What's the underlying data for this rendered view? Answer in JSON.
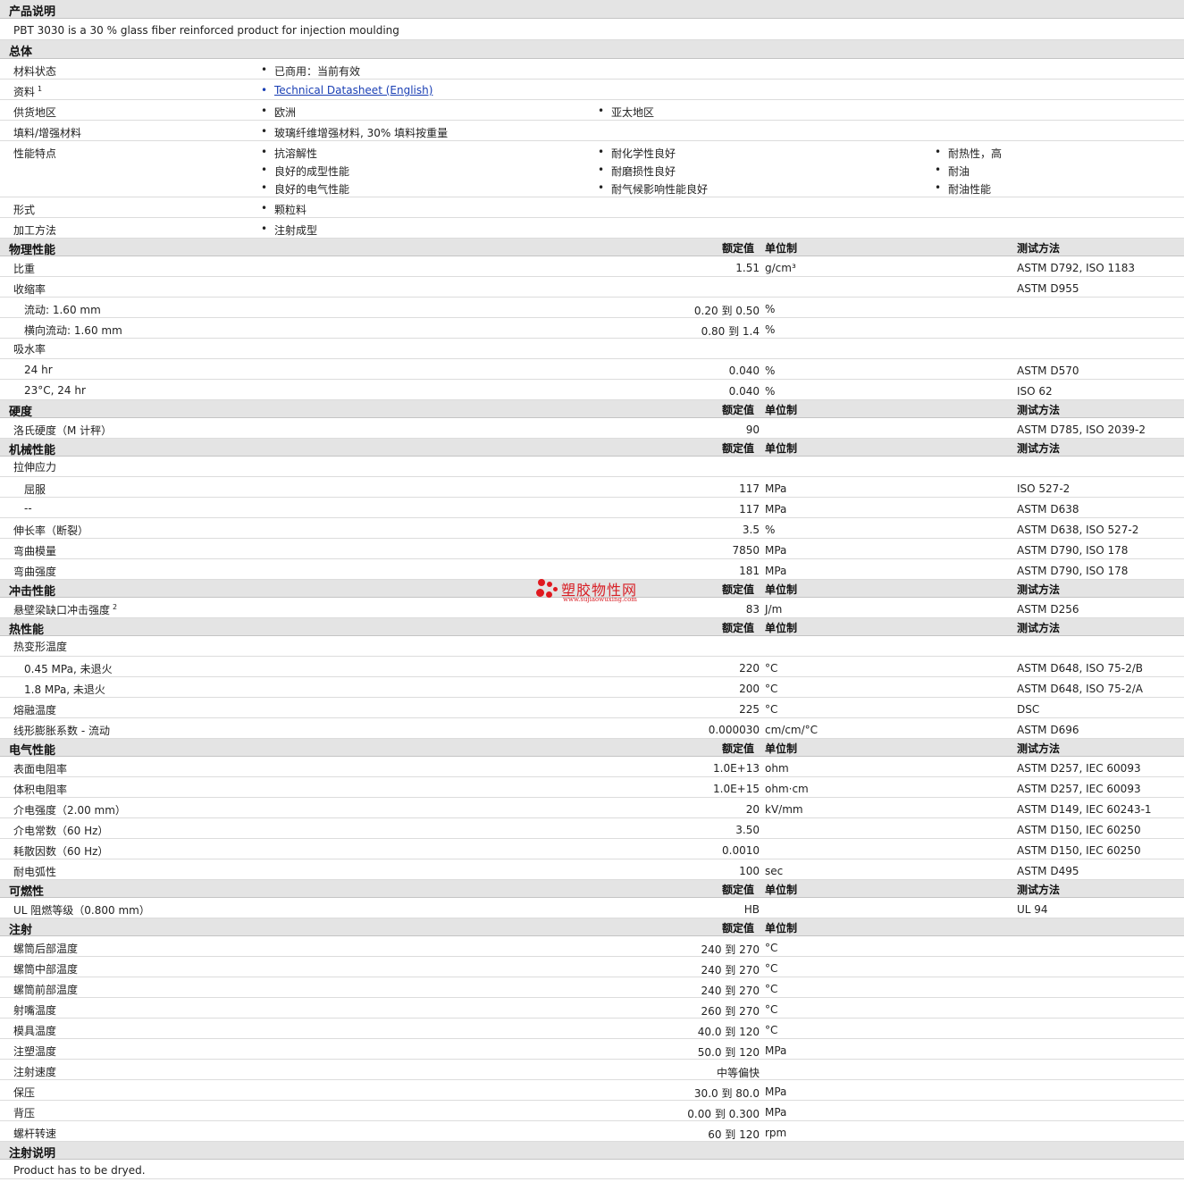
{
  "header_cols": {
    "value": "额定值",
    "unit": "单位制",
    "test": "测试方法"
  },
  "desc": {
    "title": "产品说明",
    "text": "PBT 3030 is a 30 % glass fiber reinforced product for injection moulding"
  },
  "general": {
    "title": "总体",
    "rows": [
      {
        "label": "材料状态",
        "items": [
          "已商用：当前有效"
        ]
      },
      {
        "label": "资料",
        "sup": "1",
        "items": [
          "Technical Datasheet (English)"
        ],
        "link": true
      },
      {
        "label": "供货地区",
        "items": [
          "欧洲",
          "亚太地区"
        ]
      },
      {
        "label": "填料/增强材料",
        "items": [
          "玻璃纤维增强材料, 30% 填料按重量"
        ]
      },
      {
        "label": "性能特点",
        "items": [
          "抗溶解性",
          "耐化学性良好",
          "耐热性，高",
          "良好的成型性能",
          "耐磨损性良好",
          "耐油",
          "良好的电气性能",
          "耐气候影响性能良好",
          "耐油性能"
        ]
      },
      {
        "label": "形式",
        "items": [
          "颗粒料"
        ]
      },
      {
        "label": "加工方法",
        "items": [
          "注射成型"
        ]
      }
    ]
  },
  "sections": [
    {
      "title": "物理性能",
      "rows": [
        {
          "label": "比重",
          "value": "1.51",
          "unit": "g/cm³",
          "test": "ASTM D792, ISO 1183"
        },
        {
          "label": "收缩率",
          "test": "ASTM D955"
        },
        {
          "label": "流动: 1.60 mm",
          "sub": true,
          "value": "0.20 到  0.50",
          "unit": "%"
        },
        {
          "label": "横向流动: 1.60 mm",
          "sub": true,
          "value": "0.80 到  1.4",
          "unit": "%"
        },
        {
          "label": "吸水率"
        },
        {
          "label": "24 hr",
          "sub": true,
          "value": "0.040",
          "unit": "%",
          "test": "ASTM D570"
        },
        {
          "label": "23°C, 24 hr",
          "sub": true,
          "value": "0.040",
          "unit": "%",
          "test": "ISO 62"
        }
      ]
    },
    {
      "title": "硬度",
      "rows": [
        {
          "label": "洛氏硬度（M 计秤）",
          "value": "90",
          "test": "ASTM D785, ISO 2039-2"
        }
      ]
    },
    {
      "title": "机械性能",
      "rows": [
        {
          "label": "拉伸应力"
        },
        {
          "label": "屈服",
          "sub": true,
          "value": "117",
          "unit": "MPa",
          "test": "ISO 527-2"
        },
        {
          "label": "--",
          "sub": true,
          "value": "117",
          "unit": "MPa",
          "test": "ASTM D638"
        },
        {
          "label": "伸长率（断裂）",
          "value": "3.5",
          "unit": "%",
          "test": "ASTM D638, ISO 527-2"
        },
        {
          "label": "弯曲模量",
          "value": "7850",
          "unit": "MPa",
          "test": "ASTM D790, ISO 178"
        },
        {
          "label": "弯曲强度",
          "value": "181",
          "unit": "MPa",
          "test": "ASTM D790, ISO 178"
        }
      ]
    },
    {
      "title": "冲击性能",
      "rows": [
        {
          "label": "悬壁梁缺口冲击强度",
          "sup": "2",
          "value": "83",
          "unit": "J/m",
          "test": "ASTM D256"
        }
      ]
    },
    {
      "title": "热性能",
      "rows": [
        {
          "label": "热变形温度"
        },
        {
          "label": "0.45 MPa, 未退火",
          "sub": true,
          "value": "220",
          "unit": "°C",
          "test": "ASTM D648, ISO 75-2/B"
        },
        {
          "label": "1.8 MPa, 未退火",
          "sub": true,
          "value": "200",
          "unit": "°C",
          "test": "ASTM D648, ISO 75-2/A"
        },
        {
          "label": "熔融温度",
          "value": "225",
          "unit": "°C",
          "test": "DSC"
        },
        {
          "label": "线形膨胀系数  - 流动",
          "value": "0.000030",
          "unit": "cm/cm/°C",
          "test": "ASTM D696"
        }
      ]
    },
    {
      "title": "电气性能",
      "rows": [
        {
          "label": "表面电阻率",
          "value": "1.0E+13",
          "unit": "ohm",
          "test": "ASTM D257, IEC 60093"
        },
        {
          "label": "体积电阻率",
          "value": "1.0E+15",
          "unit": "ohm·cm",
          "test": "ASTM D257, IEC 60093"
        },
        {
          "label": "介电强度（2.00 mm）",
          "value": "20",
          "unit": "kV/mm",
          "test": "ASTM D149, IEC 60243-1"
        },
        {
          "label": "介电常数（60 Hz）",
          "value": "3.50",
          "test": "ASTM D150, IEC 60250"
        },
        {
          "label": "耗散因数（60 Hz）",
          "value": "0.0010",
          "test": "ASTM D150, IEC 60250"
        },
        {
          "label": "耐电弧性",
          "value": "100",
          "unit": "sec",
          "test": "ASTM D495"
        }
      ]
    },
    {
      "title": "可燃性",
      "rows": [
        {
          "label": "UL 阻燃等级（0.800 mm）",
          "value": "HB",
          "test": "UL 94"
        }
      ]
    },
    {
      "title": "注射",
      "no_test": true,
      "rows": [
        {
          "label": "螺筒后部温度",
          "value": "240 到  270",
          "unit": "°C"
        },
        {
          "label": "螺筒中部温度",
          "value": "240 到  270",
          "unit": "°C"
        },
        {
          "label": "螺筒前部温度",
          "value": "240 到  270",
          "unit": "°C"
        },
        {
          "label": "射嘴温度",
          "value": "260 到  270",
          "unit": "°C"
        },
        {
          "label": "模具温度",
          "value": "40.0 到  120",
          "unit": "°C"
        },
        {
          "label": "注塑温度",
          "value": "50.0 到  120",
          "unit": "MPa"
        },
        {
          "label": "注射速度",
          "value": "中等偏快"
        },
        {
          "label": "保压",
          "value": "30.0 到  80.0",
          "unit": "MPa"
        },
        {
          "label": "背压",
          "value": "0.00 到  0.300",
          "unit": "MPa"
        },
        {
          "label": "螺杆转速",
          "value": "60 到  120",
          "unit": "rpm"
        }
      ]
    }
  ],
  "notes": {
    "title": "注射说明",
    "text": "Product has to be dryed."
  },
  "watermark": {
    "text": "塑胶物性网",
    "url": "www.sujiaowuxing.com"
  }
}
